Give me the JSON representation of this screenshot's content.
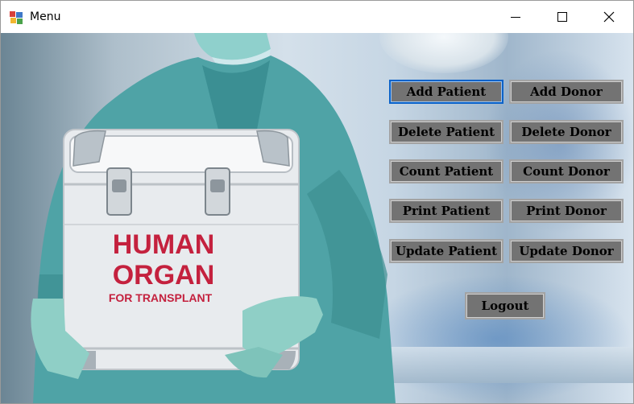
{
  "window": {
    "title": "Menu",
    "controls": [
      "minimize-icon",
      "maximize-icon",
      "close-icon"
    ]
  },
  "image": {
    "case_line1": "HUMAN",
    "case_line2": "ORGAN",
    "case_line3": "FOR TRANSPLANT"
  },
  "buttons": {
    "add_patient": "Add Patient",
    "add_donor": "Add Donor",
    "delete_patient": "Delete Patient",
    "delete_donor": "Delete Donor",
    "count_patient": "Count Patient",
    "count_donor": "Count Donor",
    "print_patient": "Print Patient",
    "print_donor": "Print Donor",
    "update_patient": "Update Patient",
    "update_donor": "Update Donor",
    "logout": "Logout"
  },
  "colors": {
    "button_face": "#737373",
    "focus_border": "#0a62c9",
    "case_text": "#c4213e"
  }
}
